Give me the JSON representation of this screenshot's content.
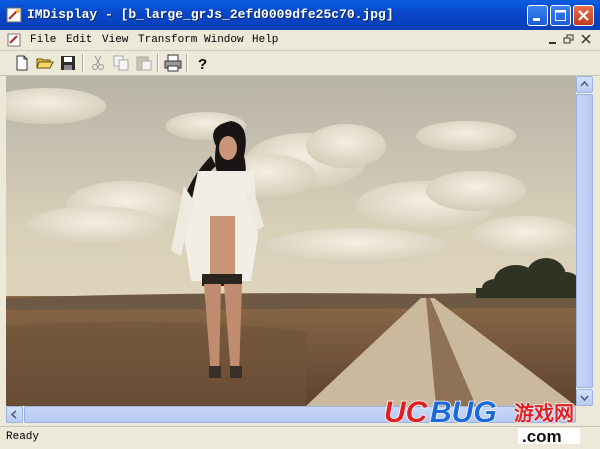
{
  "window": {
    "title": "IMDisplay - [b_large_grJs_2efd0009dfe25c70.jpg]"
  },
  "menubar": {
    "items": [
      {
        "label": "File"
      },
      {
        "label": "Edit"
      },
      {
        "label": "View"
      },
      {
        "label": "Transform"
      },
      {
        "label": "Window"
      },
      {
        "label": "Help"
      }
    ]
  },
  "toolbar": {
    "buttons": [
      "new-icon",
      "open-icon",
      "save-icon",
      "cut-icon",
      "copy-icon",
      "paste-icon",
      "print-icon",
      "help-icon"
    ]
  },
  "statusbar": {
    "text": "Ready"
  },
  "watermark": {
    "brand": "UCBUG",
    "cn": "游戏网",
    "suffix": ".com"
  },
  "colors": {
    "titlebar": "#0A4FD6",
    "chrome": "#ECE9D8",
    "sky": "#D9CCAE",
    "ground": "#7C5A3E"
  }
}
